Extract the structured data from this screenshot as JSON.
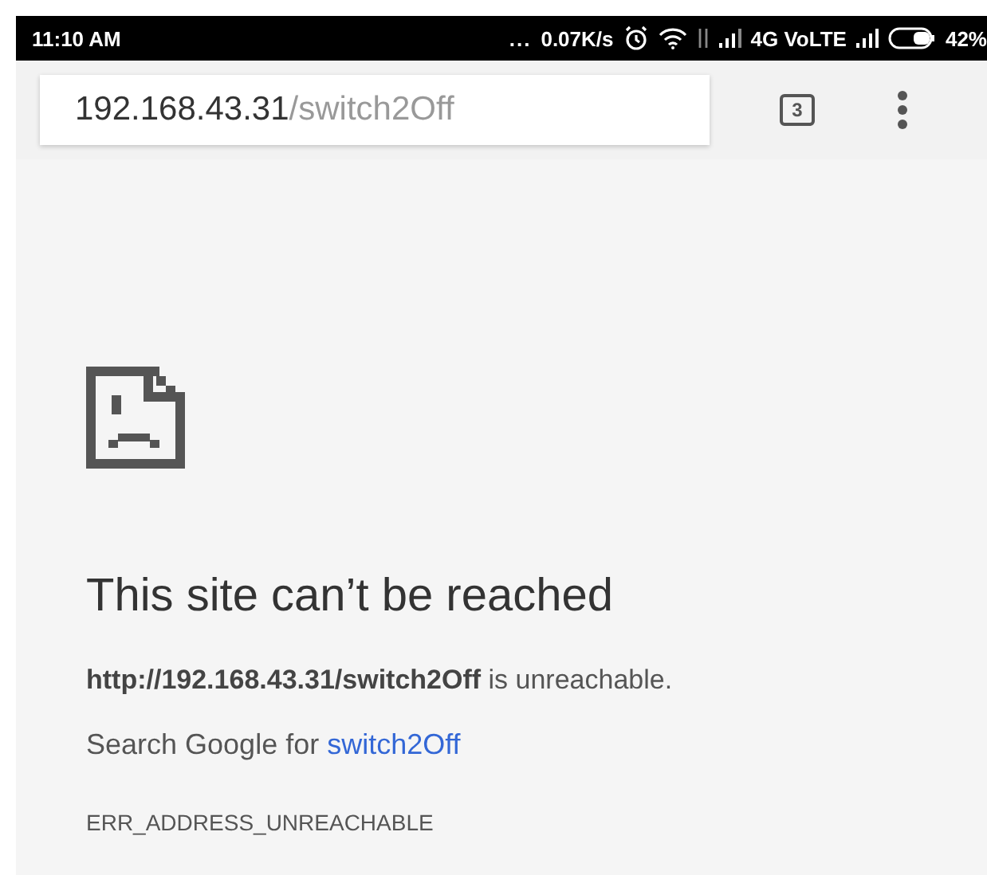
{
  "status_bar": {
    "time": "11:10 AM",
    "dots": "...",
    "speed": "0.07K/s",
    "network": "4G VoLTE",
    "battery": "42%"
  },
  "toolbar": {
    "url_host": "192.168.43.31",
    "url_path": "/switch2Off",
    "tab_count": "3"
  },
  "error_page": {
    "title": "This site can’t be reached",
    "message": "**http://192.168.43.31/switch2Off** is unreachable.",
    "search_prefix": "Search Google for ",
    "search_link": "switch2Off",
    "code": "ERR_ADDRESS_UNREACHABLE"
  }
}
